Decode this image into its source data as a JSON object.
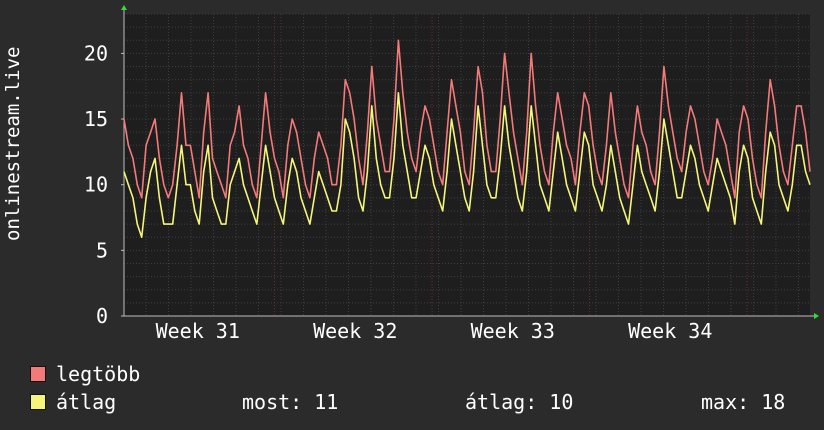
{
  "chart_data": {
    "type": "line",
    "ylabel": "onlinestream.live",
    "ylim": [
      0,
      23
    ],
    "yticks": [
      0,
      5,
      10,
      15,
      20
    ],
    "xtick_labels": [
      "Week 31",
      "Week 32",
      "Week 33",
      "Week 34"
    ],
    "grid": true,
    "series": [
      {
        "name": "legtöbb",
        "color": "#f47a7a",
        "values": [
          15,
          13,
          12,
          10,
          9,
          13,
          14,
          15,
          12,
          10,
          9,
          10,
          13,
          17,
          13,
          13,
          11,
          9,
          14,
          17,
          12,
          11,
          10,
          9,
          13,
          14,
          16,
          13,
          12,
          10,
          9,
          13,
          17,
          14,
          12,
          11,
          9,
          13,
          15,
          14,
          12,
          10,
          9,
          12,
          14,
          13,
          12,
          10,
          10,
          13,
          18,
          17,
          15,
          12,
          10,
          14,
          19,
          15,
          13,
          11,
          11,
          15,
          21,
          17,
          14,
          12,
          11,
          14,
          16,
          15,
          13,
          11,
          10,
          14,
          18,
          16,
          14,
          11,
          10,
          14,
          19,
          17,
          13,
          11,
          11,
          15,
          20,
          17,
          14,
          12,
          10,
          14,
          20,
          16,
          13,
          11,
          10,
          14,
          17,
          15,
          13,
          12,
          10,
          14,
          17,
          16,
          13,
          11,
          10,
          13,
          17,
          14,
          12,
          10,
          9,
          13,
          16,
          14,
          13,
          11,
          10,
          14,
          19,
          16,
          14,
          12,
          11,
          14,
          16,
          15,
          13,
          11,
          10,
          12,
          15,
          14,
          13,
          11,
          9,
          14,
          16,
          15,
          12,
          10,
          9,
          14,
          18,
          16,
          13,
          11,
          10,
          13,
          16,
          16,
          14,
          11
        ]
      },
      {
        "name": "átlag",
        "color": "#f5f57a",
        "values": [
          11,
          10,
          9,
          7,
          6,
          9,
          11,
          12,
          9,
          7,
          7,
          7,
          10,
          13,
          10,
          10,
          8,
          7,
          11,
          13,
          9,
          8,
          7,
          7,
          10,
          11,
          12,
          10,
          9,
          8,
          7,
          10,
          13,
          11,
          9,
          8,
          7,
          10,
          12,
          11,
          9,
          8,
          7,
          9,
          11,
          10,
          9,
          8,
          8,
          10,
          15,
          14,
          12,
          9,
          8,
          11,
          16,
          12,
          10,
          9,
          9,
          12,
          17,
          13,
          11,
          9,
          9,
          11,
          13,
          12,
          10,
          9,
          8,
          11,
          15,
          13,
          11,
          9,
          8,
          11,
          16,
          13,
          10,
          9,
          9,
          12,
          16,
          13,
          11,
          9,
          8,
          11,
          16,
          13,
          10,
          9,
          8,
          11,
          14,
          12,
          10,
          9,
          8,
          11,
          14,
          13,
          10,
          9,
          8,
          10,
          13,
          11,
          9,
          8,
          7,
          10,
          13,
          11,
          10,
          9,
          8,
          11,
          15,
          13,
          11,
          9,
          9,
          11,
          13,
          12,
          10,
          9,
          8,
          10,
          12,
          11,
          10,
          9,
          7,
          11,
          13,
          12,
          9,
          8,
          7,
          11,
          14,
          13,
          10,
          9,
          8,
          10,
          13,
          13,
          11,
          10
        ]
      }
    ]
  },
  "legend": {
    "max_label": "legtöbb",
    "avg_label": "átlag",
    "now_text": "most: 11",
    "avg_text": "átlag: 10",
    "peak_text": "max: 18"
  },
  "colors": {
    "background": "#2b2b2b",
    "plot_bg": "#1e1e1e",
    "minor_grid": "#3e3e3e",
    "major_grid": "#6b2a2a",
    "axis": "#bdbdbd",
    "arrow": "#33dd33"
  }
}
